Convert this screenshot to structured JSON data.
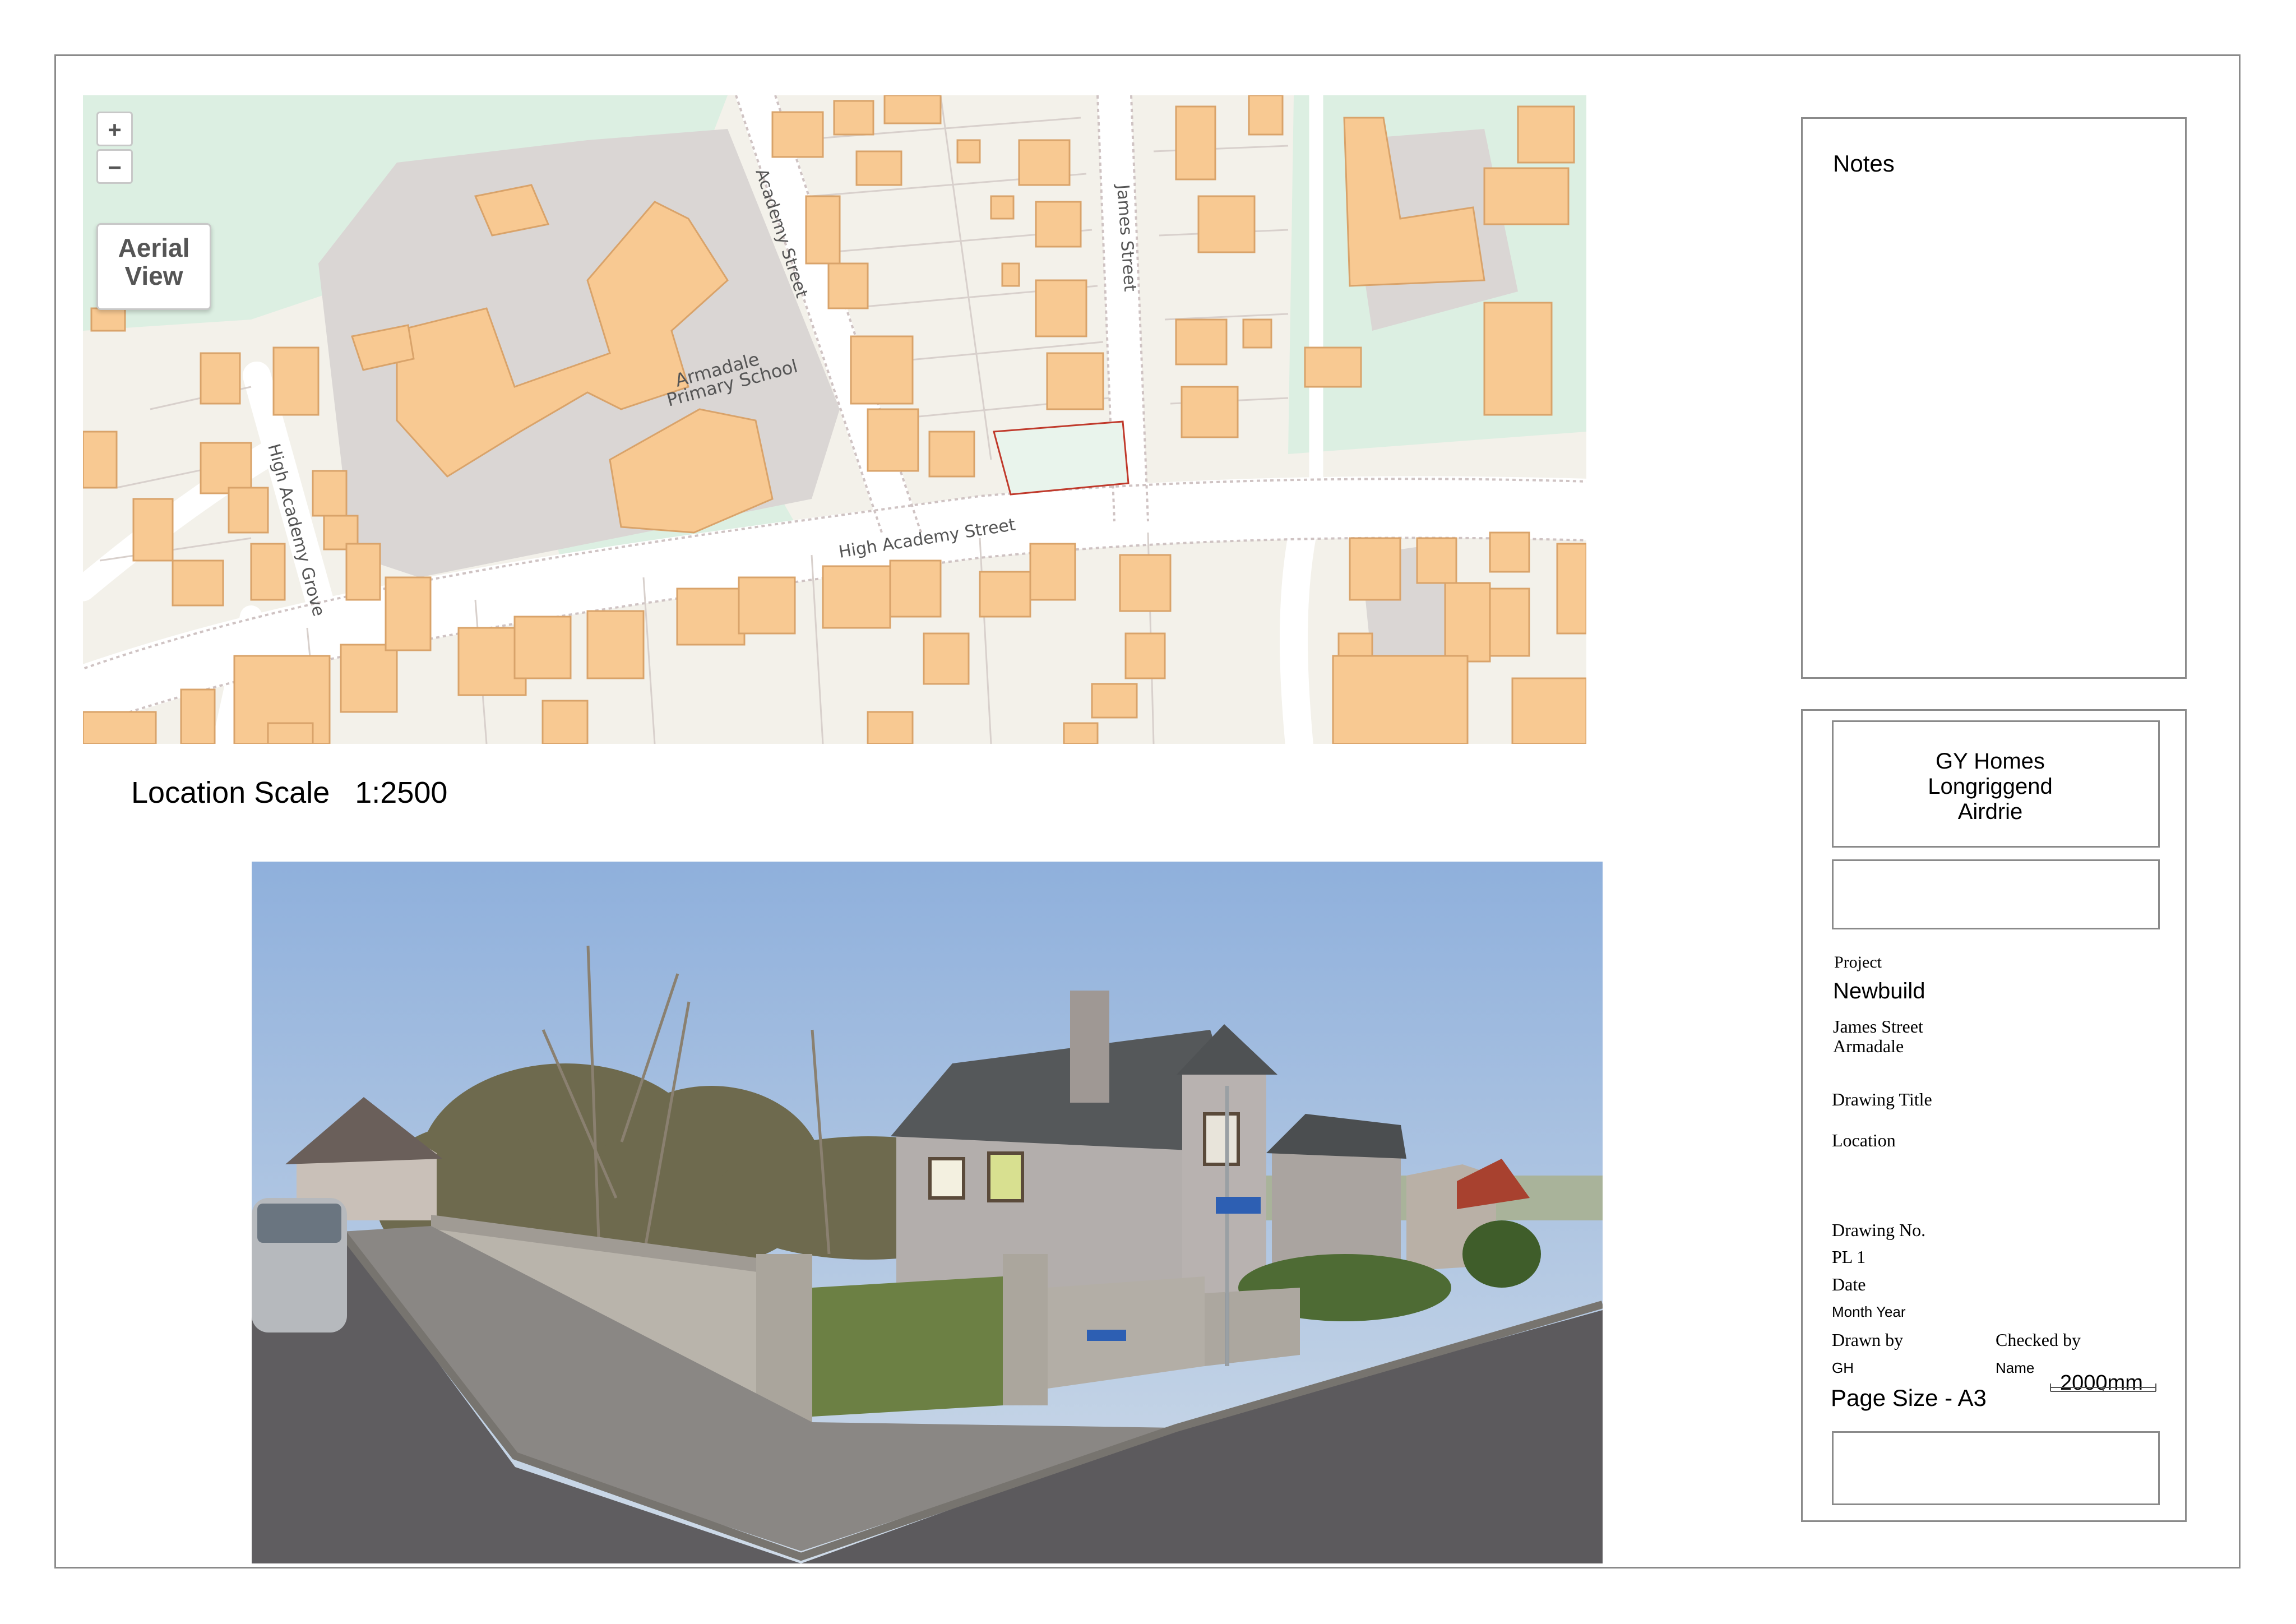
{
  "map": {
    "zoom_in": "+",
    "zoom_out": "−",
    "aerial_view": [
      "Aerial",
      "View"
    ],
    "streets": {
      "academy": "Academy Street",
      "james": "James Street",
      "high_academy": "High Academy Street",
      "high_academy_grove": "High Academy Grove",
      "school_line1": "Armadale",
      "school_line2": "Primary School"
    },
    "colors": {
      "land": "#f3f1ea",
      "building": "#f8c992",
      "green": "#dcefe2",
      "grounds": "#dad6d4",
      "road": "#ffffff",
      "site": "#e9f4ec",
      "site_outline": "#c0392b"
    }
  },
  "location_scale": "Location Scale   1:2500",
  "notes": {
    "title": "Notes"
  },
  "client": {
    "line1": "GY Homes",
    "line2": "Longriggend",
    "line3": "Airdrie"
  },
  "project": {
    "label": "Project",
    "name": "Newbuild",
    "address1": "James Street",
    "address2": "Armadale"
  },
  "drawing_title": {
    "label": "Drawing Title",
    "value": "Location"
  },
  "drawing_no": {
    "label": "Drawing No.",
    "value": "PL 1"
  },
  "date": {
    "label": "Date",
    "value": "Month Year"
  },
  "drawn_by": {
    "label": "Drawn by",
    "value": "GH"
  },
  "checked_by": {
    "label": "Checked by",
    "value": "Name"
  },
  "page_size": "Page Size - A3",
  "scale_bar": "2000mm"
}
